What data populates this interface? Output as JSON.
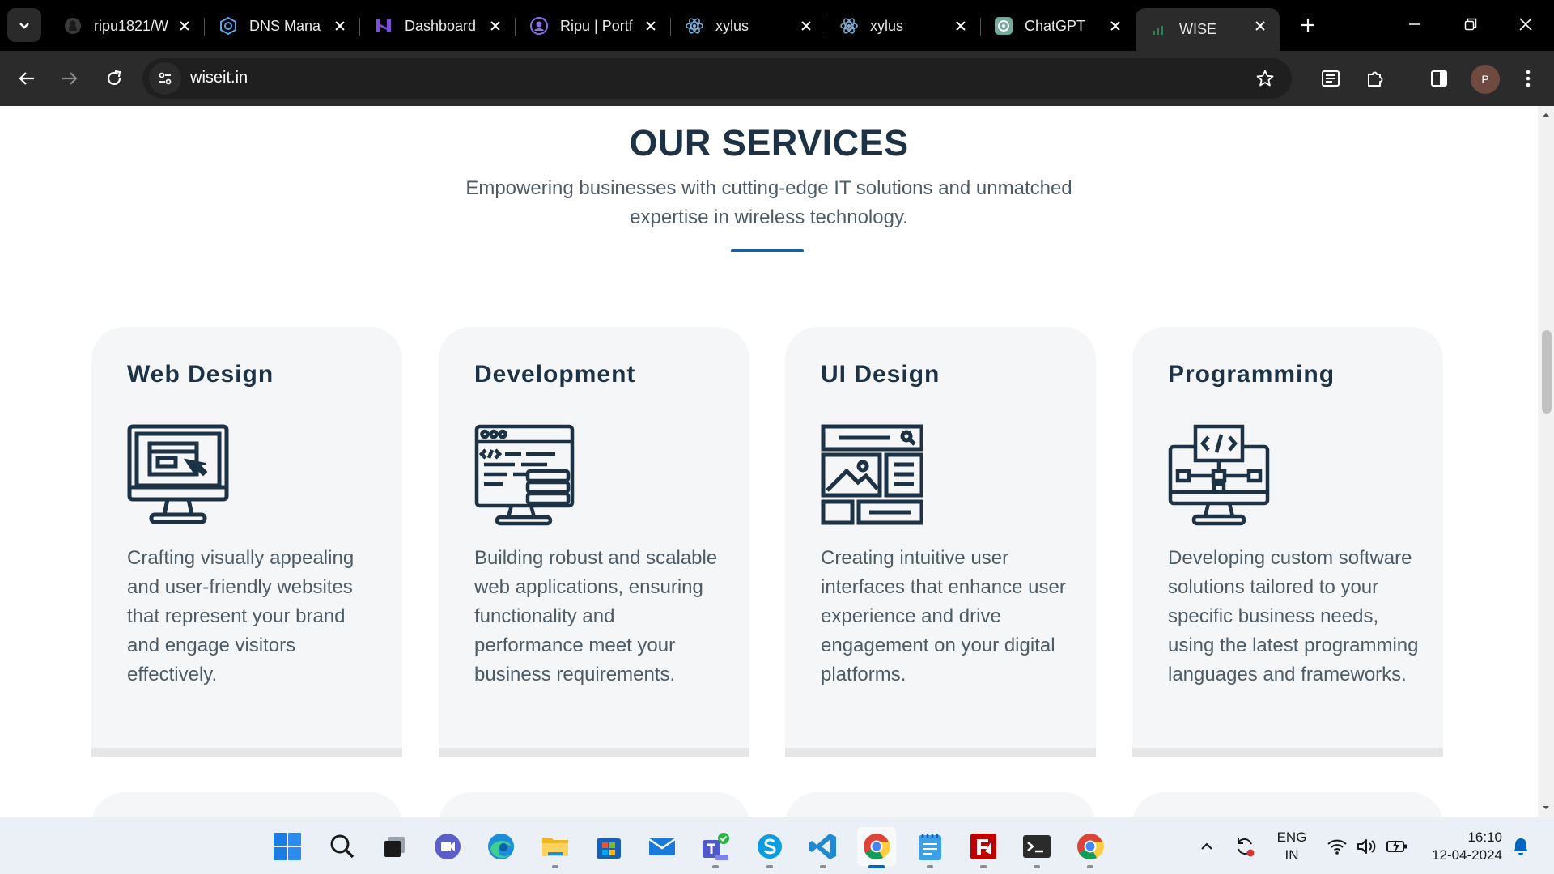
{
  "browser": {
    "tabs": [
      {
        "title": "ripu1821/W",
        "icon": "github-icon"
      },
      {
        "title": "DNS Mana",
        "icon": "dns-icon"
      },
      {
        "title": "Dashboard",
        "icon": "dashboard-icon"
      },
      {
        "title": "Ripu | Portf",
        "icon": "portfolio-icon"
      },
      {
        "title": "xylus",
        "icon": "react-icon"
      },
      {
        "title": "xylus",
        "icon": "react-icon"
      },
      {
        "title": "ChatGPT",
        "icon": "chatgpt-icon"
      },
      {
        "title": "WISE",
        "icon": "wise-icon",
        "active": true
      }
    ],
    "url": "wiseit.in",
    "profile_initial": "P"
  },
  "page": {
    "heading": "OUR SERVICES",
    "subheading": "Empowering businesses with cutting-edge IT solutions and unmatched expertise in wireless technology.",
    "accent_color": "#1d5f99",
    "services": [
      {
        "title": "Web Design",
        "icon": "web-design-icon",
        "description": "Crafting visually appealing and user-friendly websites that represent your brand and engage visitors effectively."
      },
      {
        "title": "Development",
        "icon": "development-icon",
        "description": "Building robust and scalable web applications, ensuring functionality and performance meet your business requirements."
      },
      {
        "title": "UI Design",
        "icon": "ui-design-icon",
        "description": "Creating intuitive user interfaces that enhance user experience and drive engagement on your digital platforms."
      },
      {
        "title": "Programming",
        "icon": "programming-icon",
        "description": "Developing custom software solutions tailored to your specific business needs, using the latest programming languages and frameworks."
      }
    ]
  },
  "taskbar": {
    "apps": [
      "start-icon",
      "search-icon",
      "task-view-icon",
      "meet-icon",
      "edge-icon",
      "file-explorer-icon",
      "store-icon",
      "mail-icon",
      "teams-icon",
      "skype-icon",
      "vscode-icon",
      "chrome-icon",
      "notepad-icon",
      "filezilla-icon",
      "terminal-icon",
      "chrome-icon"
    ],
    "lang_top": "ENG",
    "lang_bottom": "IN",
    "time": "16:10",
    "date": "12-04-2024"
  }
}
